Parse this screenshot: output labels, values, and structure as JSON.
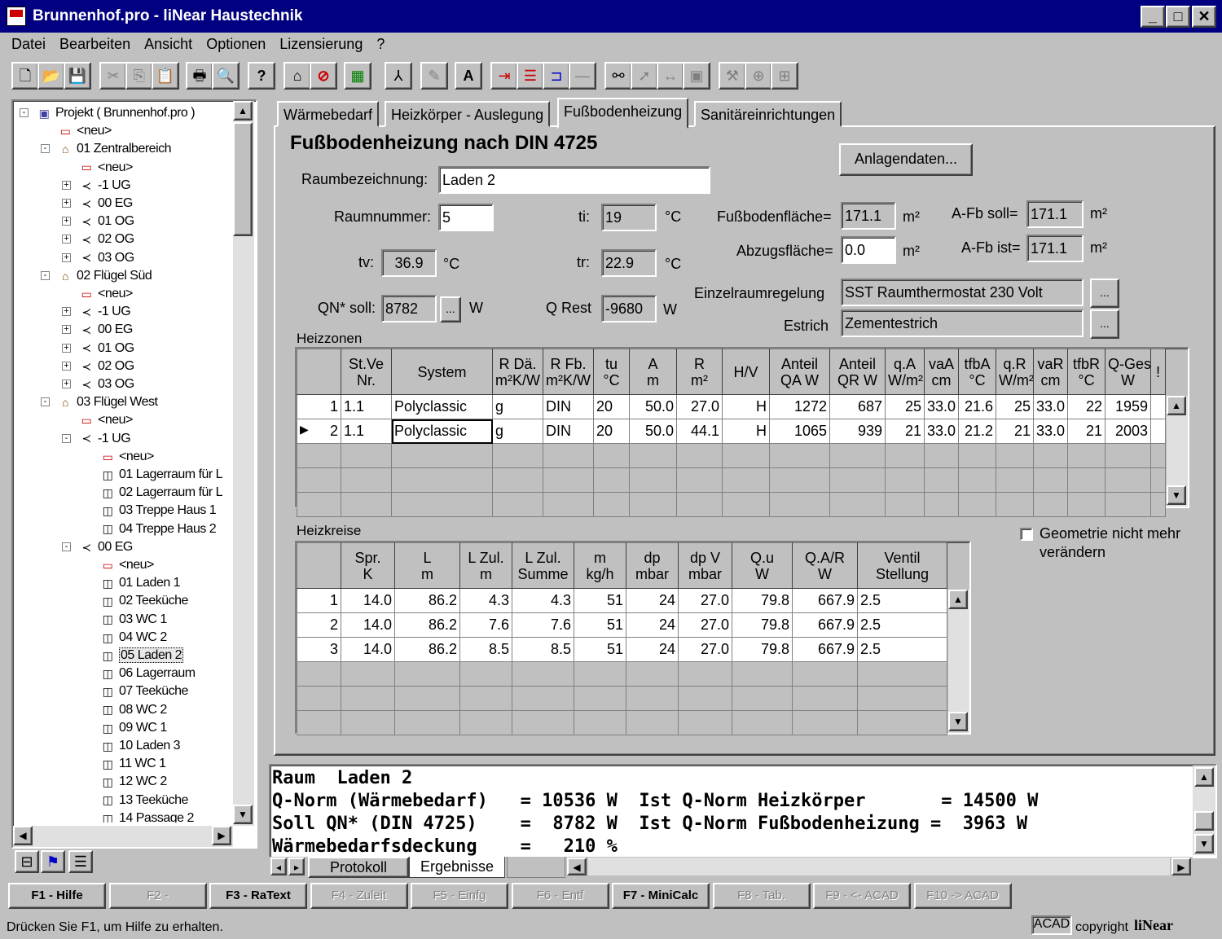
{
  "window": {
    "title": "Brunnenhof.pro - liNear Haustechnik",
    "buttons": [
      "_",
      "□",
      "✕"
    ]
  },
  "menu": [
    "Datei",
    "Bearbeiten",
    "Ansicht",
    "Optionen",
    "Lizensierung",
    "?"
  ],
  "toolbar_icons": [
    "new-icon",
    "open-icon",
    "save-icon",
    "cut-icon",
    "copy-icon",
    "paste-icon",
    "print-icon",
    "preview-icon",
    "help-icon",
    "home-icon",
    "stop-icon",
    "calc-icon",
    "pipe-icon",
    "pen-icon",
    "text-icon",
    "connect-icon",
    "split-icon",
    "bend-icon",
    "line-icon",
    "binoculars-icon",
    "pointer-icon",
    "measure-icon",
    "frame-icon",
    "tools-icon",
    "zoom-icon",
    "grid-icon"
  ],
  "tree": {
    "items": [
      {
        "label": "Projekt ( Brunnenhof.pro )",
        "level": 0,
        "icon": "project",
        "exp": "-"
      },
      {
        "label": "<neu>",
        "level": 1,
        "icon": "new"
      },
      {
        "label": "01 Zentralbereich",
        "level": 1,
        "icon": "building",
        "exp": "-"
      },
      {
        "label": "<neu>",
        "level": 2,
        "icon": "new"
      },
      {
        "label": "-1 UG",
        "level": 2,
        "icon": "floor",
        "exp": "+"
      },
      {
        "label": "00 EG",
        "level": 2,
        "icon": "floor",
        "exp": "+"
      },
      {
        "label": "01 OG",
        "level": 2,
        "icon": "floor",
        "exp": "+"
      },
      {
        "label": "02 OG",
        "level": 2,
        "icon": "floor",
        "exp": "+"
      },
      {
        "label": "03 OG",
        "level": 2,
        "icon": "floor",
        "exp": "+"
      },
      {
        "label": "02 Flügel Süd",
        "level": 1,
        "icon": "building",
        "exp": "-"
      },
      {
        "label": "<neu>",
        "level": 2,
        "icon": "new"
      },
      {
        "label": "-1 UG",
        "level": 2,
        "icon": "floor",
        "exp": "+"
      },
      {
        "label": "00 EG",
        "level": 2,
        "icon": "floor",
        "exp": "+"
      },
      {
        "label": "01 OG",
        "level": 2,
        "icon": "floor",
        "exp": "+"
      },
      {
        "label": "02 OG",
        "level": 2,
        "icon": "floor",
        "exp": "+"
      },
      {
        "label": "03 OG",
        "level": 2,
        "icon": "floor",
        "exp": "+"
      },
      {
        "label": "03 Flügel West",
        "level": 1,
        "icon": "building",
        "exp": "-"
      },
      {
        "label": "<neu>",
        "level": 2,
        "icon": "new"
      },
      {
        "label": "-1 UG",
        "level": 2,
        "icon": "floor",
        "exp": "-"
      },
      {
        "label": "<neu>",
        "level": 3,
        "icon": "new"
      },
      {
        "label": "01 Lagerraum für L",
        "level": 3,
        "icon": "room"
      },
      {
        "label": "02 Lagerraum für L",
        "level": 3,
        "icon": "room"
      },
      {
        "label": "03 Treppe Haus 1",
        "level": 3,
        "icon": "room"
      },
      {
        "label": "04 Treppe Haus 2",
        "level": 3,
        "icon": "room"
      },
      {
        "label": "00 EG",
        "level": 2,
        "icon": "floor",
        "exp": "-"
      },
      {
        "label": "<neu>",
        "level": 3,
        "icon": "new"
      },
      {
        "label": "01 Laden 1",
        "level": 3,
        "icon": "room"
      },
      {
        "label": "02 Teeküche",
        "level": 3,
        "icon": "room"
      },
      {
        "label": "03 WC 1",
        "level": 3,
        "icon": "room"
      },
      {
        "label": "04 WC 2",
        "level": 3,
        "icon": "room"
      },
      {
        "label": "05 Laden 2",
        "level": 3,
        "icon": "room",
        "selected": true
      },
      {
        "label": "06 Lagerraum",
        "level": 3,
        "icon": "room"
      },
      {
        "label": "07 Teeküche",
        "level": 3,
        "icon": "room"
      },
      {
        "label": "08 WC 2",
        "level": 3,
        "icon": "room"
      },
      {
        "label": "09 WC 1",
        "level": 3,
        "icon": "room"
      },
      {
        "label": "10 Laden 3",
        "level": 3,
        "icon": "room"
      },
      {
        "label": "11 WC 1",
        "level": 3,
        "icon": "room"
      },
      {
        "label": "12 WC 2",
        "level": 3,
        "icon": "room"
      },
      {
        "label": "13 Teeküche",
        "level": 3,
        "icon": "room"
      },
      {
        "label": "14 Passage 2",
        "level": 3,
        "icon": "room"
      }
    ]
  },
  "tabs": [
    "Wärmebedarf",
    "Heizkörper - Auslegung",
    "Fußbodenheizung",
    "Sanitäreinrichtungen"
  ],
  "form": {
    "heading": "Fußbodenheizung nach DIN 4725",
    "anlagendaten_btn": "Anlagendaten...",
    "raumbezeichnung_label": "Raumbezeichnung:",
    "raumbezeichnung": "Laden 2",
    "raumnummer_label": "Raumnummer:",
    "raumnummer": "5",
    "ti_label": "ti:",
    "ti": "19",
    "ti_unit": "°C",
    "tv_label": "tv:",
    "tv": "36.9",
    "tv_unit": "°C",
    "tr_label": "tr:",
    "tr": "22.9",
    "tr_unit": "°C",
    "qn_label": "QN* soll:",
    "qn": "8782",
    "qn_btn": "...",
    "qn_unit": "W",
    "qrest_label": "Q Rest",
    "qrest": "-9680",
    "qrest_unit": "W",
    "fbflaeche_label": "Fußbodenfläche=",
    "fbflaeche": "171.1",
    "fbflaeche_unit": "m²",
    "afbsoll_label": "A-Fb soll=",
    "afbsoll": "171.1",
    "afbsoll_unit": "m²",
    "abzug_label": "Abzugsfläche=",
    "abzug": "0.0",
    "abzug_unit": "m²",
    "afbist_label": "A-Fb ist=",
    "afbist": "171.1",
    "afbist_unit": "m²",
    "regelung_label": "Einzelraumregelung",
    "regelung": "SST Raumthermostat 230 Volt",
    "estrich_label": "Estrich",
    "estrich": "Zementestrich",
    "dots": "...",
    "geometrie_label": "Geometrie nicht mehr verändern"
  },
  "heizzonen": {
    "title": "Heizzonen",
    "headers": [
      "",
      "St.Ve\nNr.",
      "System",
      "R Dä.\nm²K/W",
      "R Fb.\nm²K/W",
      "tu\n°C",
      "A\nm",
      "R\nm²",
      "H/V",
      "Anteil\nQA W",
      "Anteil\nQR W",
      "q.A\nW/m²",
      "vaA\ncm",
      "tfbA\n°C",
      "q.R\nW/m²",
      "vaR\ncm",
      "tfbR\n°C",
      "Q-Ges\nW",
      "!"
    ],
    "rows": [
      [
        "1",
        "1.1",
        "Polyclassic",
        "g",
        "DIN",
        "20",
        "50.0",
        "27.0",
        "H",
        "1272",
        "687",
        "25",
        "33.0",
        "21.6",
        "25",
        "33.0",
        "22",
        "1959",
        ""
      ],
      [
        "2",
        "1.1",
        "Polyclassic",
        "g",
        "DIN",
        "20",
        "50.0",
        "44.1",
        "H",
        "1065",
        "939",
        "21",
        "33.0",
        "21.2",
        "21",
        "33.0",
        "21",
        "2003",
        ""
      ]
    ],
    "current_row_marker": "▶"
  },
  "heizkreise": {
    "title": "Heizkreise",
    "headers": [
      "",
      "Spr.\nK",
      "L\nm",
      "L Zul.\nm",
      "L Zul.\nSumme",
      "m\nkg/h",
      "dp\nmbar",
      "dp V\nmbar",
      "Q.u\nW",
      "Q.A/R\nW",
      "Ventil\nStellung"
    ],
    "rows": [
      [
        "1",
        "14.0",
        "86.2",
        "4.3",
        "4.3",
        "51",
        "24",
        "27.0",
        "79.8",
        "667.9",
        "2.5"
      ],
      [
        "2",
        "14.0",
        "86.2",
        "7.6",
        "7.6",
        "51",
        "24",
        "27.0",
        "79.8",
        "667.9",
        "2.5"
      ],
      [
        "3",
        "14.0",
        "86.2",
        "8.5",
        "8.5",
        "51",
        "24",
        "27.0",
        "79.8",
        "667.9",
        "2.5"
      ]
    ]
  },
  "output": {
    "lines": [
      "Raum  Laden 2",
      "Q-Norm (Wärmebedarf)   = 10536 W  Ist Q-Norm Heizkörper       = 14500 W",
      "Soll QN* (DIN 4725)    =  8782 W  Ist Q-Norm Fußbodenheizung =  3963 W",
      "Wärmebedarfsdeckung    =   210 %"
    ],
    "tabs": [
      "Protokoll",
      "Ergebnisse"
    ]
  },
  "fkeys": [
    {
      "label": "F1 - Hilfe",
      "enabled": true
    },
    {
      "label": "F2 -",
      "enabled": false
    },
    {
      "label": "F3 - RaText",
      "enabled": true
    },
    {
      "label": "F4 - Zuleit",
      "enabled": false
    },
    {
      "label": "F5 - Einfg",
      "enabled": false
    },
    {
      "label": "F6 - Entf",
      "enabled": false
    },
    {
      "label": "F7 - MiniCalc",
      "enabled": true
    },
    {
      "label": "F8 - Tab.",
      "enabled": false
    },
    {
      "label": "F9 - <- ACAD",
      "enabled": false
    },
    {
      "label": "F10 -> ACAD",
      "enabled": false
    }
  ],
  "status": {
    "text": "Drücken Sie F1, um Hilfe zu erhalten.",
    "acad": "ACAD",
    "copyright": "copyright",
    "brand": "liNear"
  },
  "colors": {
    "titlebar": "#000080",
    "window_bg": "#c0c0c0",
    "field_bg": "#ffffff"
  }
}
